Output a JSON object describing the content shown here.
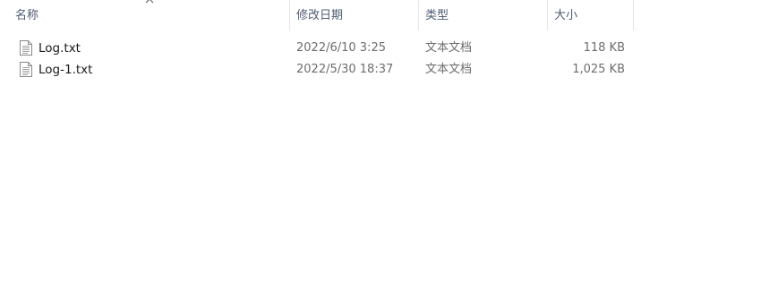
{
  "columns": {
    "name": "名称",
    "date_modified": "修改日期",
    "type": "类型",
    "size": "大小"
  },
  "files": [
    {
      "name": "Log.txt",
      "date_modified": "2022/6/10 3:25",
      "type": "文本文档",
      "size": "118 KB",
      "icon": "text-file-icon"
    },
    {
      "name": "Log-1.txt",
      "date_modified": "2022/5/30 18:37",
      "type": "文本文档",
      "size": "1,025 KB",
      "icon": "text-file-icon"
    }
  ],
  "sort_indicator": "sort-ascending-icon"
}
